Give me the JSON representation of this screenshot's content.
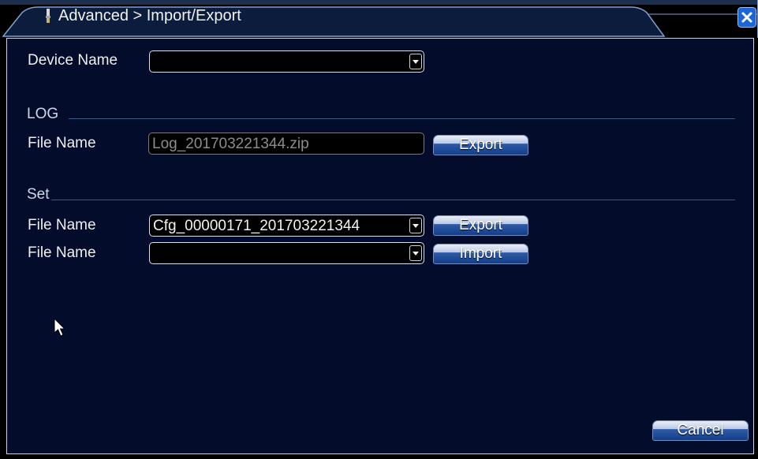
{
  "window": {
    "title": "Advanced > Import/Export",
    "title_icon": "tool-icon",
    "close_icon": "close-icon"
  },
  "device": {
    "label": "Device Name",
    "value": ""
  },
  "log_section": {
    "heading": "LOG",
    "file_label": "File Name",
    "file_value": "Log_201703221344.zip",
    "export_label": "Export"
  },
  "set_section": {
    "heading": "Set",
    "export_row": {
      "file_label": "File Name",
      "file_value": "Cfg_00000171_201703221344",
      "button_label": "Export"
    },
    "import_row": {
      "file_label": "File Name",
      "file_value": "",
      "button_label": "Import"
    }
  },
  "footer": {
    "cancel_label": "Cancel"
  },
  "colors": {
    "panel_bg": "#040c2c",
    "title_bar": "#0b1c3c",
    "button_blue": "#123f8c",
    "close_blue": "#1a66d8"
  }
}
